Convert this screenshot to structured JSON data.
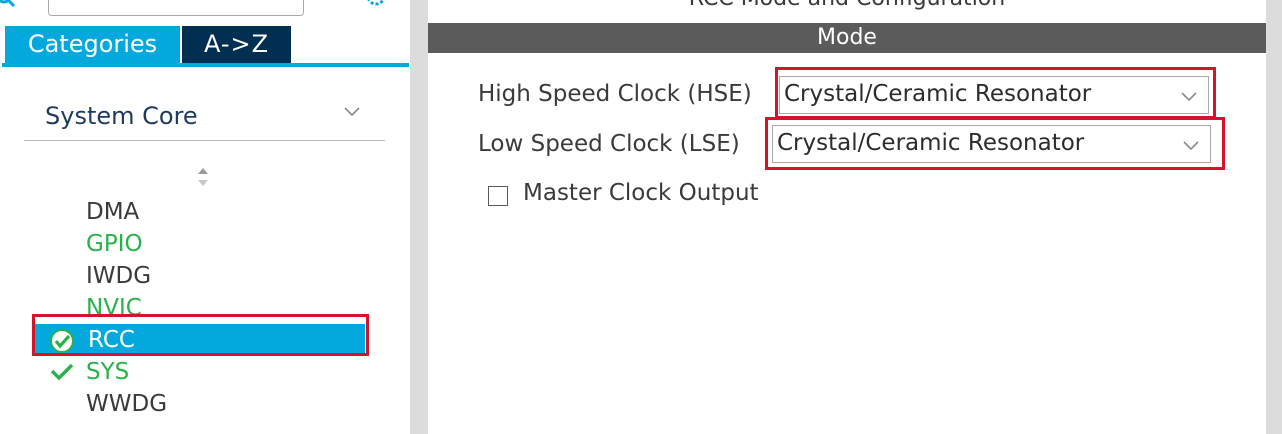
{
  "colors": {
    "accent": "#03a9dc",
    "dark_tab": "#002f52",
    "enabled_green": "#2ab24a",
    "highlight_red": "#d5132c",
    "mode_header": "#5b5b5b"
  },
  "left": {
    "search_placeholder": "",
    "tabs": [
      {
        "label": "Categories",
        "active": true
      },
      {
        "label": "A->Z",
        "active": false
      }
    ],
    "category": "System Core",
    "peripherals": [
      {
        "name": "DMA",
        "state": "gray"
      },
      {
        "name": "GPIO",
        "state": "green"
      },
      {
        "name": "IWDG",
        "state": "gray"
      },
      {
        "name": "NVIC",
        "state": "green"
      },
      {
        "name": "RCC",
        "state": "selected",
        "icon": "check-circle-icon"
      },
      {
        "name": "SYS",
        "state": "green",
        "icon": "check-icon"
      },
      {
        "name": "WWDG",
        "state": "gray"
      }
    ]
  },
  "right": {
    "title": "RCC Mode and Configuration",
    "section": "Mode",
    "hse": {
      "label": "High Speed Clock (HSE)",
      "value": "Crystal/Ceramic Resonator"
    },
    "lse": {
      "label": "Low Speed Clock (LSE)",
      "value": "Crystal/Ceramic Resonator"
    },
    "mco": {
      "label": "Master Clock Output",
      "checked": false
    }
  }
}
